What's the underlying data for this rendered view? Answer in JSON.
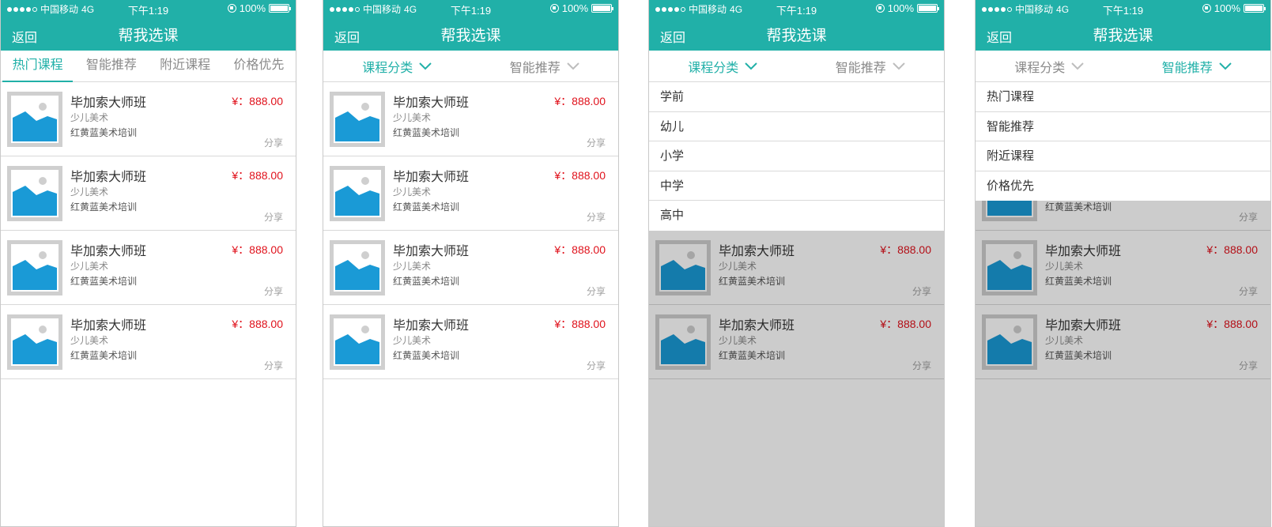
{
  "status_bar": {
    "carrier": "中国移动",
    "network": "4G",
    "time": "下午1:19",
    "battery": "100%",
    "battery_level": 1.0
  },
  "nav": {
    "back_label": "返回",
    "title": "帮我选课"
  },
  "tabs": [
    "热门课程",
    "智能推荐",
    "附近课程",
    "价格优先"
  ],
  "filters": {
    "category_label": "课程分类",
    "recommend_label": "智能推荐"
  },
  "course": {
    "title": "毕加索大师班",
    "price": "¥：888.00",
    "category": "少儿美术",
    "org": "红黄蓝美术培训",
    "share": "分享"
  },
  "category_options": [
    "学前",
    "幼儿",
    "小学",
    "中学",
    "高中"
  ],
  "sort_options": [
    "热门课程",
    "智能推荐",
    "附近课程",
    "价格优先"
  ],
  "colors": {
    "brand": "#21b0a8",
    "price": "#e0121c",
    "image_blue": "#1a9ad6",
    "image_frame": "#cfcfcf"
  }
}
